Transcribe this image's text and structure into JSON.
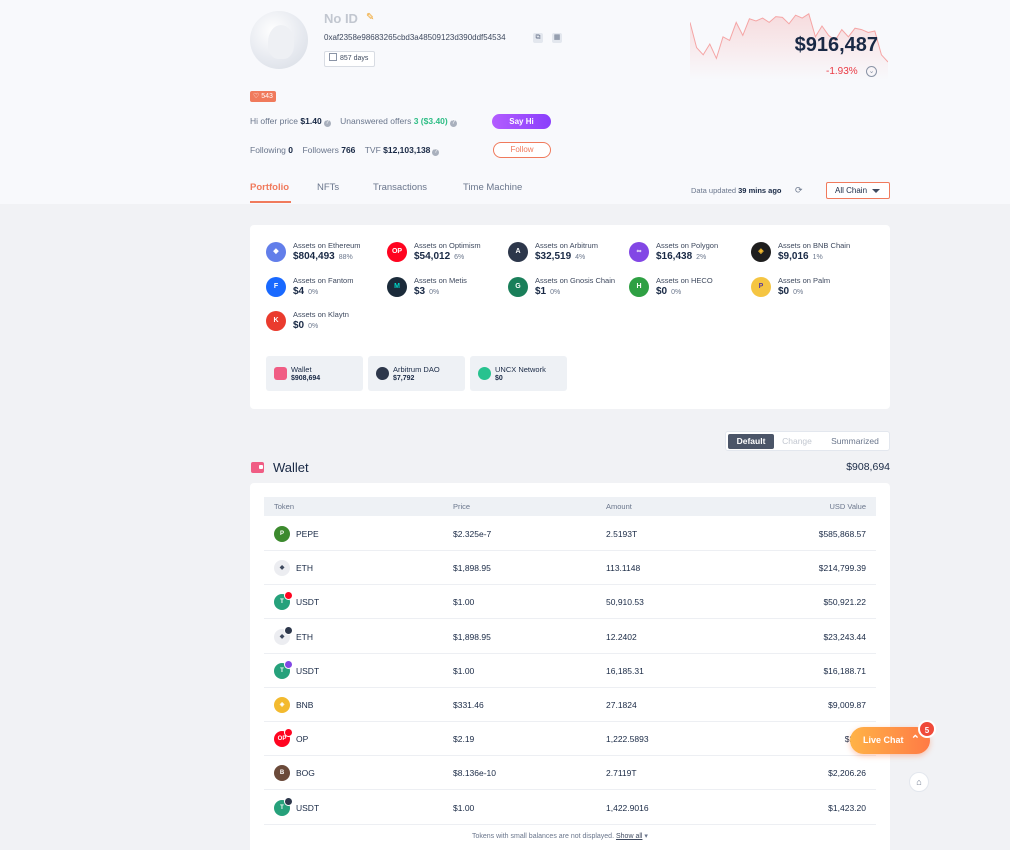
{
  "profile": {
    "name": "No ID",
    "address": "0xaf2358e98683265cbd3a48509123d390ddf54534",
    "days": "857 days",
    "badge": "543",
    "hi_offer_label": "Hi offer price",
    "hi_offer_value": "$1.40",
    "unanswered_label": "Unanswered offers",
    "unanswered_value": "3 ($3.40)",
    "say_hi": "Say Hi",
    "following_label": "Following",
    "following_value": "0",
    "followers_label": "Followers",
    "followers_value": "766",
    "tvf_label": "TVF",
    "tvf_value": "$12,103,138",
    "follow": "Follow"
  },
  "balance": {
    "usd": "$916,487",
    "change": "-1.93%",
    "spark_color": "#f5a5a5",
    "spark_series": [
      0.8,
      0.45,
      0.35,
      0.5,
      0.3,
      0.6,
      0.55,
      0.8,
      0.62,
      0.85,
      0.82,
      0.86,
      0.8,
      0.88,
      0.87,
      0.78,
      0.9,
      0.86,
      0.92,
      0.6,
      0.75,
      0.62,
      0.55,
      0.7,
      0.6,
      0.72,
      0.7,
      0.66,
      0.68,
      0.35,
      0.25
    ]
  },
  "tabs": [
    {
      "label": "Portfolio"
    },
    {
      "label": "NFTs"
    },
    {
      "label": "Transactions"
    },
    {
      "label": "Time Machine"
    }
  ],
  "updated": {
    "label": "Data updated",
    "value": "39 mins ago"
  },
  "chain_select": "All Chain",
  "chains": [
    {
      "label": "Assets on Ethereum",
      "value": "$804,493",
      "pct": "88%",
      "color": "#627eea",
      "glyph": "◆"
    },
    {
      "label": "Assets on Optimism",
      "value": "$54,012",
      "pct": "6%",
      "color": "#ff0420",
      "glyph": "OP"
    },
    {
      "label": "Assets on Arbitrum",
      "value": "$32,519",
      "pct": "4%",
      "color": "#2d374b",
      "glyph": "A"
    },
    {
      "label": "Assets on Polygon",
      "value": "$16,438",
      "pct": "2%",
      "color": "#8247e5",
      "glyph": "∞"
    },
    {
      "label": "Assets on BNB Chain",
      "value": "$9,016",
      "pct": "1%",
      "color": "#1e1e1e",
      "glyph": "◈"
    },
    {
      "label": "Assets on Fantom",
      "value": "$4",
      "pct": "0%",
      "color": "#1969ff",
      "glyph": "F"
    },
    {
      "label": "Assets on Metis",
      "value": "$3",
      "pct": "0%",
      "color": "#1b2b3a",
      "glyph": "M"
    },
    {
      "label": "Assets on Gnosis Chain",
      "value": "$1",
      "pct": "0%",
      "color": "#1a7f5a",
      "glyph": "G"
    },
    {
      "label": "Assets on HECO",
      "value": "$0",
      "pct": "0%",
      "color": "#2ea043",
      "glyph": "H"
    },
    {
      "label": "Assets on Palm",
      "value": "$0",
      "pct": "0%",
      "color": "#f5c542",
      "glyph": "P"
    },
    {
      "label": "Assets on Klaytn",
      "value": "$0",
      "pct": "0%",
      "color": "#ea3b2e",
      "glyph": "K"
    }
  ],
  "protocols": [
    {
      "label": "Wallet",
      "value": "$908,694",
      "color": "#f05d84"
    },
    {
      "label": "Arbitrum DAO",
      "value": "$7,792",
      "color": "#2d374b"
    },
    {
      "label": "UNCX Network",
      "value": "$0",
      "color": "#28c28f"
    }
  ],
  "view_toggle": [
    "Default",
    "Change",
    "Summarized"
  ],
  "wallet": {
    "title": "Wallet",
    "total": "$908,694"
  },
  "table": {
    "headers": [
      "Token",
      "Price",
      "Amount",
      "USD Value"
    ],
    "rows": [
      {
        "token": "PEPE",
        "price": "$2.325e-7",
        "amount": "2.5193T",
        "usd": "$585,868.57",
        "color": "#3c8a2e",
        "glyph": "P",
        "chain": ""
      },
      {
        "token": "ETH",
        "price": "$1,898.95",
        "amount": "113.1148",
        "usd": "$214,799.39",
        "color": "#ecedf1",
        "glyph": "◆",
        "chain": ""
      },
      {
        "token": "USDT",
        "price": "$1.00",
        "amount": "50,910.53",
        "usd": "$50,921.22",
        "color": "#26a17b",
        "glyph": "T",
        "chain": "#ff0420"
      },
      {
        "token": "ETH",
        "price": "$1,898.95",
        "amount": "12.2402",
        "usd": "$23,243.44",
        "color": "#ecedf1",
        "glyph": "◆",
        "chain": "#2d374b"
      },
      {
        "token": "USDT",
        "price": "$1.00",
        "amount": "16,185.31",
        "usd": "$16,188.71",
        "color": "#26a17b",
        "glyph": "T",
        "chain": "#8247e5"
      },
      {
        "token": "BNB",
        "price": "$331.46",
        "amount": "27.1824",
        "usd": "$9,009.87",
        "color": "#f3ba2f",
        "glyph": "◈",
        "chain": ""
      },
      {
        "token": "OP",
        "price": "$2.19",
        "amount": "1,222.5893",
        "usd": "$2,67",
        "color": "#ff0420",
        "glyph": "OP",
        "chain": "#ff0420"
      },
      {
        "token": "BOG",
        "price": "$8.136e-10",
        "amount": "2.7119T",
        "usd": "$2,206.26",
        "color": "#6b4a3a",
        "glyph": "B",
        "chain": ""
      },
      {
        "token": "USDT",
        "price": "$1.00",
        "amount": "1,422.9016",
        "usd": "$1,423.20",
        "color": "#26a17b",
        "glyph": "T",
        "chain": "#2d374b"
      }
    ],
    "footer_text": "Tokens with small balances are not displayed.",
    "footer_link": "Show all"
  },
  "live_chat": {
    "label": "Live Chat",
    "count": "5"
  }
}
